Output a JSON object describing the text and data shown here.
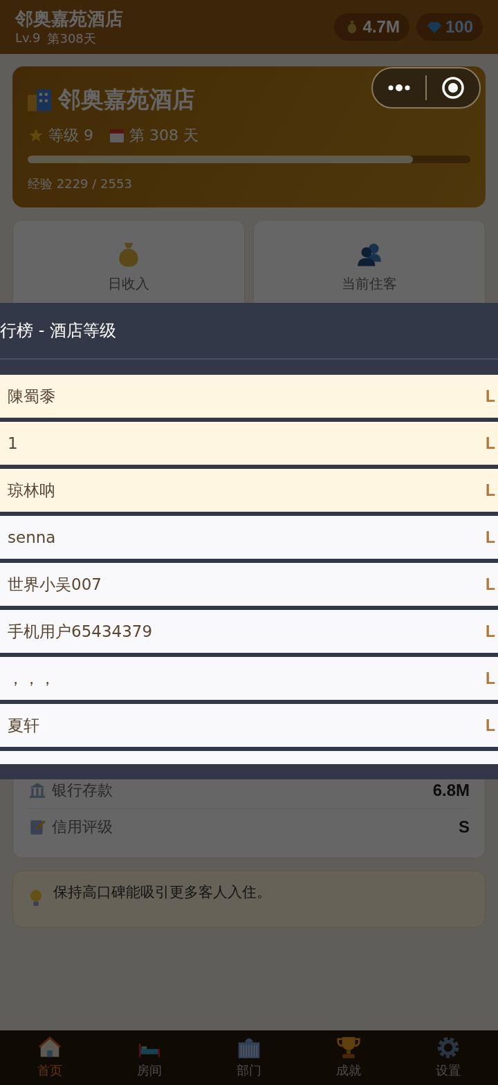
{
  "header": {
    "title": "邻奥嘉苑酒店",
    "level": "Lv.9",
    "day": "第308天",
    "coins": "4.7M",
    "gems": "100"
  },
  "hotel_card": {
    "name": "邻奥嘉苑酒店",
    "grade": "等级 9",
    "day": "第 308 天",
    "experience": {
      "level": 0.87,
      "text": "经验 2229 / 2553"
    }
  },
  "stat_cards": [
    {
      "kind": "income",
      "label": "日收入"
    },
    {
      "kind": "guests",
      "label": "当前住客"
    }
  ],
  "finance": [
    {
      "kind": "bank",
      "label": "银行存款",
      "value": "6.8M"
    },
    {
      "kind": "credit",
      "label": "信用评级",
      "value": "S"
    }
  ],
  "tip": "保持高口碑能吸引更多客人入住。",
  "leaderboard": {
    "title": "行榜 - 酒店等级",
    "rows": [
      {
        "name": "陳蜀黍",
        "level": "L",
        "highlighted": true
      },
      {
        "name": "1",
        "level": "L",
        "highlighted": true
      },
      {
        "name": "琼林呐",
        "level": "L",
        "highlighted": true
      },
      {
        "name": "senna",
        "level": "L",
        "highlighted": false
      },
      {
        "name": "世界小吴007",
        "level": "L",
        "highlighted": false
      },
      {
        "name": "手机用户65434379",
        "level": "L",
        "highlighted": false
      },
      {
        "name": "，，，",
        "level": "L",
        "highlighted": false
      },
      {
        "name": "夏轩",
        "level": "L",
        "highlighted": false
      },
      {
        "highlighted": false
      }
    ]
  },
  "tab_bar": [
    {
      "kind": "home",
      "label": "首页",
      "selected": true
    },
    {
      "kind": "rooms",
      "label": "房间",
      "selected": false
    },
    {
      "kind": "departments",
      "label": "部门",
      "selected": false
    },
    {
      "kind": "achievements",
      "label": "成就",
      "selected": false
    },
    {
      "kind": "settings",
      "label": "设置",
      "selected": false
    }
  ]
}
